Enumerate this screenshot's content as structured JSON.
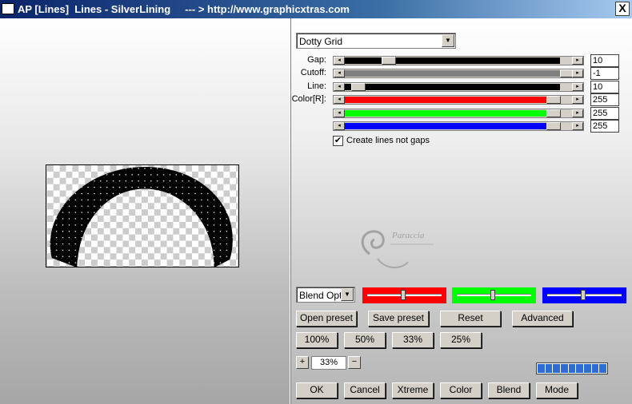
{
  "window": {
    "title": "AP [Lines]  Lines - SilverLining     --- > http://www.graphicxtras.com",
    "close_label": "X"
  },
  "controls": {
    "preset_dropdown": "Dotty Grid",
    "sliders": [
      {
        "label": "Gap:",
        "value": "10",
        "color": "#000000"
      },
      {
        "label": "Cutoff:",
        "value": "-1",
        "color": "#808080"
      },
      {
        "label": "Line:",
        "value": "10",
        "color": "#000000"
      },
      {
        "label": "Color[R]:",
        "value": "255",
        "color": "#ff0000"
      },
      {
        "label": "",
        "value": "255",
        "color": "#00ff00"
      },
      {
        "label": "",
        "value": "255",
        "color": "#0000ff"
      }
    ],
    "checkbox_label": "Create lines not gaps",
    "checkbox_checked": "✔"
  },
  "blend": {
    "dropdown": "Blend Opti",
    "colors": [
      "#ff0000",
      "#00ff00",
      "#0000ff"
    ]
  },
  "buttons": {
    "open_preset": "Open preset",
    "save_preset": "Save preset",
    "reset": "Reset",
    "advanced": "Advanced",
    "zoom100": "100%",
    "zoom50": "50%",
    "zoom33": "33%",
    "zoom25": "25%",
    "ok": "OK",
    "cancel": "Cancel",
    "xtreme": "Xtreme",
    "color": "Color",
    "blend": "Blend",
    "mode": "Mode"
  },
  "zoom": {
    "plus": "+",
    "minus": "−",
    "value": "33%"
  },
  "watermark": {
    "name": "Paraccia"
  }
}
